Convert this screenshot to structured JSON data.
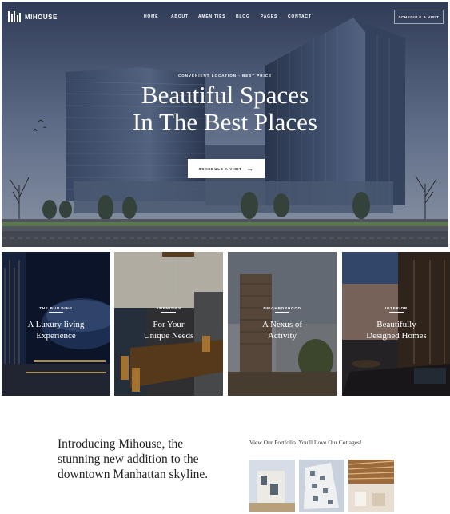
{
  "nav": {
    "logo_text": "MIHOUSE",
    "items": [
      "HOME",
      "ABOUT",
      "AMENITIES",
      "BLOG",
      "PAGES",
      "CONTACT"
    ],
    "cta": "SCHEDULE A VISIT"
  },
  "hero": {
    "eyebrow": "CONVENIENT LOCATION - BEST PRICE",
    "headline_line1": "Beautiful Spaces",
    "headline_line2": "In The Best Places",
    "button_label": "SCHEDULE A VISIT",
    "button_icon": "arrow-right-icon"
  },
  "cards": [
    {
      "category": "THE BUILDING",
      "title_line1": "A Luxury living",
      "title_line2": "Experience"
    },
    {
      "category": "AMENITIES",
      "title_line1": "For Your",
      "title_line2": "Unique Needs"
    },
    {
      "category": "NEIGHBORHOOD",
      "title_line1": "A Nexus of",
      "title_line2": "Activity"
    },
    {
      "category": "INTERIOR",
      "title_line1": "Beautifully",
      "title_line2": "Designed Homes"
    }
  ],
  "intro": {
    "text": "Introducing Mihouse, the stunning new addition to the downtown Manhattan skyline."
  },
  "portfolio": {
    "label": "View Our Portfolio. You'll Love Our Cottages!"
  }
}
